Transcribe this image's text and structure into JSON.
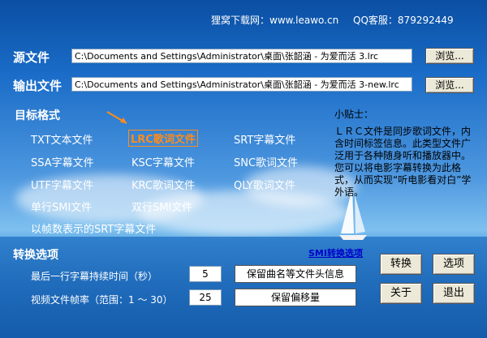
{
  "header": {
    "download_site": "狸窝下载网：www.leawo.cn",
    "qq_service": "QQ客服：879292449"
  },
  "source": {
    "label": "源文件",
    "path": "C:\\Documents and Settings\\Administrator\\桌面\\张韶涵 - 为爱而活 3.lrc",
    "browse": "浏览..."
  },
  "output": {
    "label": "输出文件",
    "path": "C:\\Documents and Settings\\Administrator\\桌面\\张韶涵 - 为爱而活 3-new.lrc",
    "browse": "浏览..."
  },
  "target_format": {
    "label": "目标格式",
    "selected": "LRC歌词文件",
    "formats": [
      "TXT文本文件",
      "LRC歌词文件",
      "SRT字幕文件",
      "SSA字幕文件",
      "KSC字幕文件",
      "SNC歌词文件",
      "UTF字幕文件",
      "KRC歌词文件",
      "QLY歌词文件",
      "单行SMI文件",
      "双行SMI文件",
      "以帧数表示的SRT字幕文件"
    ]
  },
  "tips": {
    "title": "小贴士：",
    "text": "ＬＲＣ文件是同步歌词文件，内含时间标签信息。此类型文件广泛用于各种随身听和播放器中。您可以将电影字幕转换为此格式，从而实现“听电影看对白”学外语。"
  },
  "options": {
    "label": "转换选项",
    "smi_link": "SMI转换选项",
    "last_line_label": "最后一行字幕持续时间（秒）",
    "last_line_value": "5",
    "keep_header_button": "保留曲名等文件头信息",
    "framerate_label": "视频文件帧率（范围：1 ～ 30）",
    "framerate_value": "25",
    "keep_offset_button": "保留偏移量"
  },
  "actions": {
    "convert": "转换",
    "options": "选项",
    "about": "关于",
    "exit": "退出"
  }
}
